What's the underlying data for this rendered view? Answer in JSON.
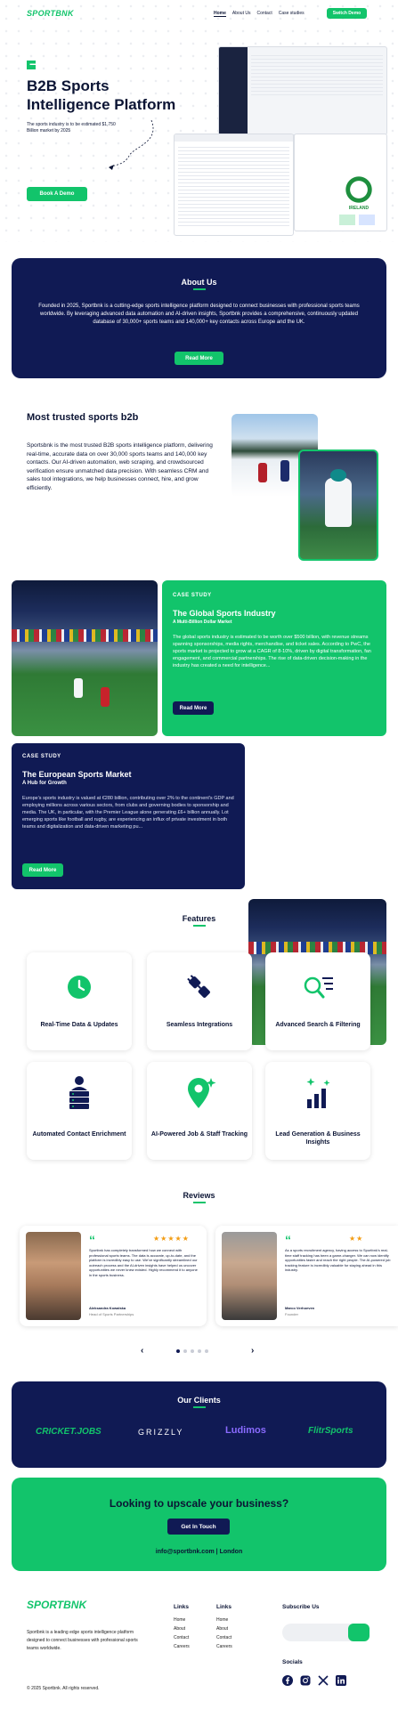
{
  "brand": {
    "name": "SPORTBNK"
  },
  "nav": {
    "items": [
      "Home",
      "About Us",
      "Contact",
      "Case studies"
    ],
    "cta": "Switch Demo"
  },
  "hero": {
    "title_line1": "B2B Sports",
    "title_line2": "Intelligence Platform",
    "subtitle": "The sports industry is to be estimated $1,750 Billion market by 2025",
    "cta": "Book A Demo",
    "badge_text": "IRELAND"
  },
  "about": {
    "heading": "About Us",
    "body": "Founded in 2025, Sportbnk is a cutting-edge sports intelligence platform designed to connect businesses with professional sports teams worldwide. By leveraging advanced data automation and AI-driven insights, Sportbnk provides a comprehensive, continuously updated database of 30,000+ sports teams and 140,000+ key contacts across Europe and the UK.",
    "cta": "Read More"
  },
  "trusted": {
    "heading": "Most trusted sports b2b",
    "body": "Sportsbnk is the most trusted B2B sports intelligence platform, delivering real-time, accurate data on over 30,000 sports teams and 140,000 key contacts. Our AI-driven automation, web scraping, and crowdsourced verification ensure unmatched data precision. With seamless CRM and sales tool integrations, we help businesses connect, hire, and grow efficiently."
  },
  "case1": {
    "tag": "CASE STUDY",
    "title": "The Global Sports Industry",
    "subtitle": "A Multi-Billion Dollar Market",
    "body": "The global sports industry is estimated to be worth over $500 billion, with revenue streams spanning sponsorships, media rights, merchandise, and ticket sales. According to PwC, the sports market is projected to grow at a CAGR of 8-10%, driven by digital transformation, fan engagement, and commercial partnerships. The rise of data-driven decision-making in the industry has created a need for intelligence...",
    "cta": "Read More"
  },
  "case2": {
    "tag": "CASE STUDY",
    "title": "The European Sports Market",
    "subtitle": "A Hub for Growth",
    "body": "Europe's sports industry is valued at €280 billion, contributing over 2% to the continent's GDP and employing millions across various sectors, from clubs and governing bodies to sponsorship and media. The UK, in particular, with the Premier League alone generating £6+ billion annually. Lot emerging sports like football and rugby, are experiencing an influx of private investment in both teams and digitalization and data-driven marketing pu...",
    "cta": "Read More"
  },
  "features": {
    "heading": "Features",
    "items": [
      {
        "label": "Real-Time Data & Updates",
        "icon": "clock-icon"
      },
      {
        "label": "Seamless Integrations",
        "icon": "plug-icon"
      },
      {
        "label": "Advanced Search & Filtering",
        "icon": "search-filter-icon"
      },
      {
        "label": "Automated Contact Enrichment",
        "icon": "server-user-icon"
      },
      {
        "label": "AI-Powered Job & Staff Tracking",
        "icon": "location-sparkle-icon"
      },
      {
        "label": "Lead Generation & Business Insights",
        "icon": "chart-sparkle-icon"
      }
    ]
  },
  "reviews": {
    "heading": "Reviews",
    "items": [
      {
        "stars": "★★★★★",
        "text": "Sportbnk has completely transformed how we connect with professional sports teams. The data is accurate, up-to-date, and the platform is incredibly easy to use. We've significantly streamlined our outreach process and the AI-driven insights have helped us uncover opportunities we never knew existed. Highly recommend it to anyone in the sports business.",
        "name": "Aleksandra Kowalska",
        "role": "Head of Sports Partnerships"
      },
      {
        "stars": "★★",
        "text": "As a sports recruitment agency, having access to Sportbnk's real-time staff tracking has been a game-changer. We can now identify opportunities faster and reach the right people. The AI-powered job tracking feature is incredibly valuable for staying ahead in this industry.",
        "name": "Marco Verhoeven",
        "role": "Founder"
      }
    ]
  },
  "clients": {
    "heading": "Our Clients",
    "logos": [
      "CRICKET.JOBS",
      "GRIZZLY",
      "Ludimos",
      "FlitrSports"
    ]
  },
  "cta_banner": {
    "heading": "Looking to upscale your business?",
    "button": "Get In Touch",
    "email": "info@sportbnk.com",
    "location": "London"
  },
  "footer": {
    "tagline": "Sportbnk is a leading edge sports intelligence platform designed to connect businesses with professional sports teams worldwide.",
    "copyright": "2025 Sportbnk. All rights reserved.",
    "links1_title": "Links",
    "links1": [
      "Home",
      "About",
      "Contact",
      "Careers"
    ],
    "links2_title": "Links",
    "links2": [
      "Home",
      "About",
      "Contact",
      "Careers"
    ],
    "subscribe_title": "Subscribe Us",
    "socials_title": "Socials"
  },
  "colors": {
    "primary": "#12c46b",
    "navy": "#101a54"
  }
}
